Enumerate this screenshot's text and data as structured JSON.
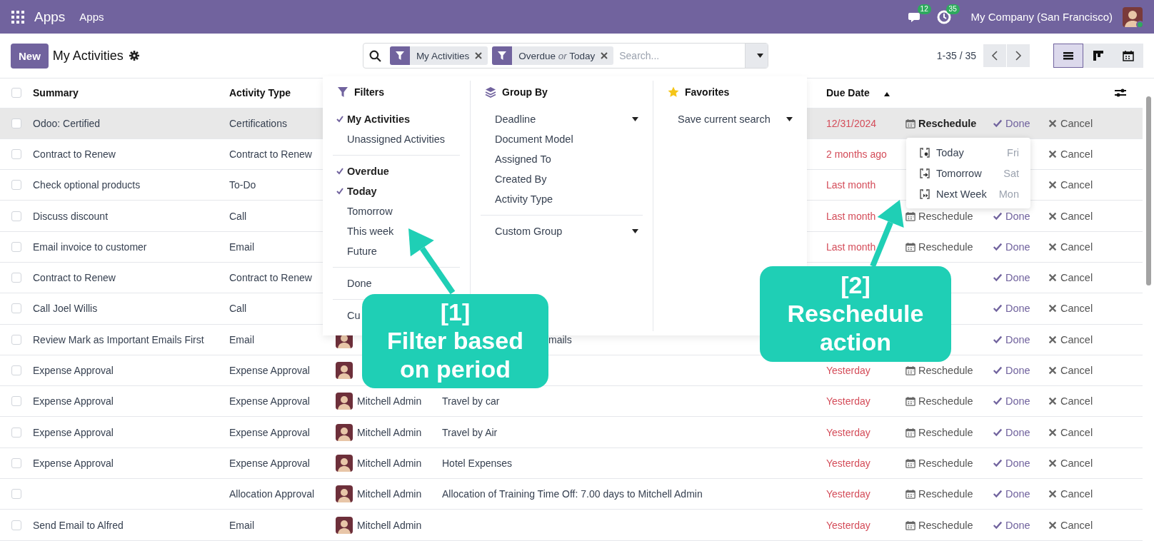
{
  "navbar": {
    "app_name": "Apps",
    "menus": [
      "Apps"
    ],
    "systray": [
      {
        "kind": "chat",
        "badge": "12"
      },
      {
        "kind": "activity",
        "badge": "35"
      }
    ],
    "company": "My Company (San Francisco)"
  },
  "control_panel": {
    "new_button": "New",
    "title": "My Activities",
    "search": {
      "facets": [
        {
          "values": [
            "My Activities"
          ]
        },
        {
          "values": [
            "Overdue",
            "Today"
          ],
          "separator": "or"
        }
      ],
      "placeholder": "Search..."
    },
    "pager": "1-35 / 35",
    "views": [
      {
        "kind": "list",
        "selected": true
      },
      {
        "kind": "kanban",
        "selected": false
      },
      {
        "kind": "calendar",
        "selected": false
      }
    ]
  },
  "table": {
    "select_all_checked": false,
    "columns": [
      {
        "label": "Summary",
        "sorted": false
      },
      {
        "label": "Activity Type",
        "sorted": false
      },
      {
        "label": "Due Date",
        "sorted": true
      }
    ],
    "rows": [
      {
        "highlighted": true,
        "checked": false,
        "summary": "Odoo: Certified",
        "activity_type": "Certifications",
        "due": "12/31/2024",
        "actions": [
          {
            "kind": "reschedule",
            "label": "Reschedule",
            "open": true
          },
          {
            "kind": "done",
            "label": "Done"
          },
          {
            "kind": "cancel",
            "label": "Cancel"
          }
        ]
      },
      {
        "highlighted": false,
        "checked": false,
        "summary": "Contract to Renew",
        "activity_type": "Contract to Renew",
        "due": "2 months ago",
        "actions": [
          {
            "kind": "cancel",
            "label": "Cancel"
          }
        ]
      },
      {
        "highlighted": false,
        "checked": false,
        "summary": "Check optional products",
        "activity_type": "To-Do",
        "due": "Last month",
        "actions": [
          {
            "kind": "cancel",
            "label": "Cancel"
          }
        ]
      },
      {
        "highlighted": false,
        "checked": false,
        "summary": "Discuss discount",
        "activity_type": "Call",
        "due": "Last month",
        "actions": [
          {
            "kind": "reschedule",
            "label": "Reschedule",
            "open": false
          },
          {
            "kind": "done",
            "label": "Done"
          },
          {
            "kind": "cancel",
            "label": "Cancel"
          }
        ]
      },
      {
        "highlighted": false,
        "checked": false,
        "summary": "Email invoice to customer",
        "activity_type": "Email",
        "due": "Last month",
        "actions": [
          {
            "kind": "reschedule",
            "label": "Reschedule",
            "open": false
          },
          {
            "kind": "done",
            "label": "Done"
          },
          {
            "kind": "cancel",
            "label": "Cancel"
          }
        ]
      },
      {
        "highlighted": false,
        "checked": false,
        "summary": "Contract to Renew",
        "activity_type": "Contract to Renew",
        "actions": [
          {
            "kind": "done",
            "label": "Done"
          },
          {
            "kind": "cancel",
            "label": "Cancel"
          }
        ]
      },
      {
        "highlighted": false,
        "checked": false,
        "summary": "Call Joel Willis",
        "activity_type": "Call",
        "actions": [
          {
            "kind": "done",
            "label": "Done"
          },
          {
            "kind": "cancel",
            "label": "Cancel"
          }
        ]
      },
      {
        "highlighted": false,
        "checked": false,
        "summary": "Review Mark as Important Emails First",
        "activity_type": "Email",
        "assigned": {
          "avatar": true
        },
        "note": {
          "text": "mails",
          "cut_start": true
        },
        "actions": [
          {
            "kind": "done",
            "label": "Done"
          },
          {
            "kind": "cancel",
            "label": "Cancel"
          }
        ]
      },
      {
        "highlighted": false,
        "checked": false,
        "summary": "Expense Approval",
        "activity_type": "Expense Approval",
        "assigned": {
          "avatar": true
        },
        "due": "Yesterday",
        "actions": [
          {
            "kind": "reschedule",
            "label": "Reschedule",
            "open": false
          },
          {
            "kind": "done",
            "label": "Done"
          },
          {
            "kind": "cancel",
            "label": "Cancel"
          }
        ]
      },
      {
        "highlighted": false,
        "checked": false,
        "summary": "Expense Approval",
        "activity_type": "Expense Approval",
        "assigned": {
          "avatar": true,
          "name": "Mitchell Admin"
        },
        "note": {
          "text": "Travel by car"
        },
        "due": "Yesterday",
        "actions": [
          {
            "kind": "reschedule",
            "label": "Reschedule",
            "open": false
          },
          {
            "kind": "done",
            "label": "Done"
          },
          {
            "kind": "cancel",
            "label": "Cancel"
          }
        ]
      },
      {
        "highlighted": false,
        "checked": false,
        "summary": "Expense Approval",
        "activity_type": "Expense Approval",
        "assigned": {
          "avatar": true,
          "name": "Mitchell Admin"
        },
        "note": {
          "text": "Travel by Air"
        },
        "due": "Yesterday",
        "actions": [
          {
            "kind": "reschedule",
            "label": "Reschedule",
            "open": false
          },
          {
            "kind": "done",
            "label": "Done"
          },
          {
            "kind": "cancel",
            "label": "Cancel"
          }
        ]
      },
      {
        "highlighted": false,
        "checked": false,
        "summary": "Expense Approval",
        "activity_type": "Expense Approval",
        "assigned": {
          "avatar": true,
          "name": "Mitchell Admin"
        },
        "note": {
          "text": "Hotel Expenses"
        },
        "due": "Yesterday",
        "actions": [
          {
            "kind": "reschedule",
            "label": "Reschedule",
            "open": false
          },
          {
            "kind": "done",
            "label": "Done"
          },
          {
            "kind": "cancel",
            "label": "Cancel"
          }
        ]
      },
      {
        "highlighted": false,
        "checked": false,
        "activity_type": "Allocation Approval",
        "assigned": {
          "avatar": true,
          "name": "Mitchell Admin"
        },
        "note": {
          "text": "Allocation of Training Time Off: 7.00 days to Mitchell Admin"
        },
        "due": "Yesterday",
        "actions": [
          {
            "kind": "reschedule",
            "label": "Reschedule",
            "open": false
          },
          {
            "kind": "done",
            "label": "Done"
          },
          {
            "kind": "cancel",
            "label": "Cancel"
          }
        ]
      },
      {
        "highlighted": false,
        "checked": false,
        "summary": "Send Email to Alfred",
        "activity_type": "Email",
        "assigned": {
          "avatar": true,
          "name": "Mitchell Admin"
        },
        "due": "Yesterday",
        "actions": [
          {
            "kind": "reschedule",
            "label": "Reschedule",
            "open": false
          },
          {
            "kind": "done",
            "label": "Done"
          },
          {
            "kind": "cancel",
            "label": "Cancel"
          }
        ]
      }
    ]
  },
  "search_panel": {
    "filters": {
      "title": "Filters",
      "groups": [
        [
          {
            "label": "My Activities",
            "checked": true
          },
          {
            "label": "Unassigned Activities",
            "checked": false
          }
        ],
        [
          {
            "label": "Overdue",
            "checked": true
          },
          {
            "label": "Today",
            "checked": true
          },
          {
            "label": "Tomorrow",
            "checked": false
          },
          {
            "label": "This week",
            "checked": false
          },
          {
            "label": "Future",
            "checked": false
          }
        ],
        [
          {
            "label": "Done",
            "checked": false
          }
        ],
        [
          {
            "label": "Cu",
            "checked": false
          }
        ]
      ]
    },
    "group_by": {
      "title": "Group By",
      "groups": [
        [
          {
            "label": "Deadline",
            "submenu": true
          },
          {
            "label": "Document Model",
            "submenu": false
          },
          {
            "label": "Assigned To",
            "submenu": false
          },
          {
            "label": "Created By",
            "submenu": false
          },
          {
            "label": "Activity Type",
            "submenu": false
          }
        ],
        [
          {
            "label": "Custom Group",
            "submenu": true
          }
        ]
      ]
    },
    "favorites": {
      "title": "Favorites",
      "items": [
        {
          "label": "Save current search",
          "submenu": true
        }
      ]
    }
  },
  "reschedule_menu": [
    {
      "kind": "today",
      "label": "Today",
      "day": "Fri"
    },
    {
      "kind": "tomorrow",
      "label": "Tomorrow",
      "day": "Sat"
    },
    {
      "kind": "next_week",
      "label": "Next Week",
      "day": "Mon"
    }
  ],
  "callouts": [
    {
      "number": "[1]",
      "caption": "Filter based on period"
    },
    {
      "number": "[2]",
      "caption": "Reschedule action"
    }
  ]
}
